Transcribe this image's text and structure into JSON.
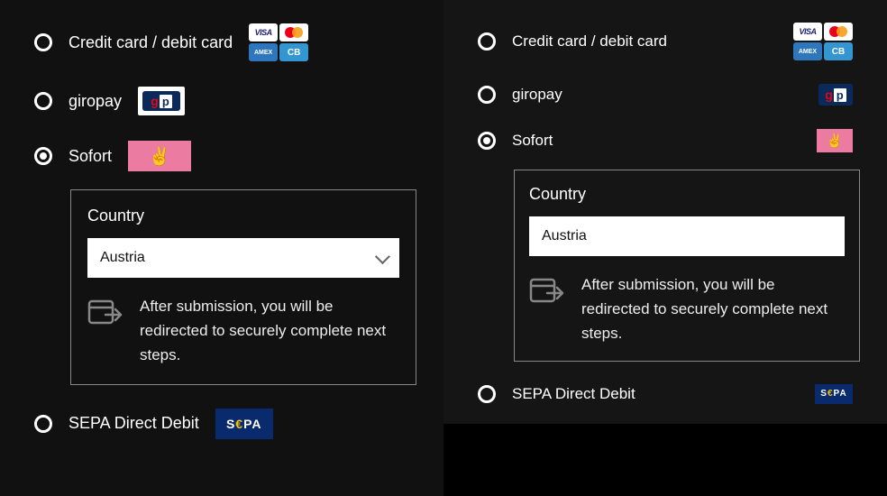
{
  "left": {
    "options": [
      {
        "id": "card",
        "label": "Credit card / debit card",
        "selected": false
      },
      {
        "id": "giropay",
        "label": "giropay",
        "selected": false
      },
      {
        "id": "sofort",
        "label": "Sofort",
        "selected": true
      },
      {
        "id": "sepa",
        "label": "SEPA Direct Debit",
        "selected": false
      }
    ],
    "details": {
      "title": "Country",
      "selected_value": "Austria",
      "hint": "After submission, you will be redirected to securely complete next steps."
    }
  },
  "right": {
    "options": [
      {
        "id": "card",
        "label": "Credit card / debit card",
        "selected": false
      },
      {
        "id": "giropay",
        "label": "giropay",
        "selected": false
      },
      {
        "id": "sofort",
        "label": "Sofort",
        "selected": true
      },
      {
        "id": "sepa",
        "label": "SEPA Direct Debit",
        "selected": false
      }
    ],
    "details": {
      "title": "Country",
      "selected_value": "Austria",
      "hint": "After submission, you will be redirected to securely complete next steps."
    }
  },
  "badges": {
    "visa": "VISA",
    "amex": "AMEX",
    "cb": "CB",
    "sepa_s": "S",
    "sepa_e": "€",
    "sepa_pa": "PA",
    "gp_g": "g",
    "gp_p": "p",
    "peace": "✌"
  }
}
